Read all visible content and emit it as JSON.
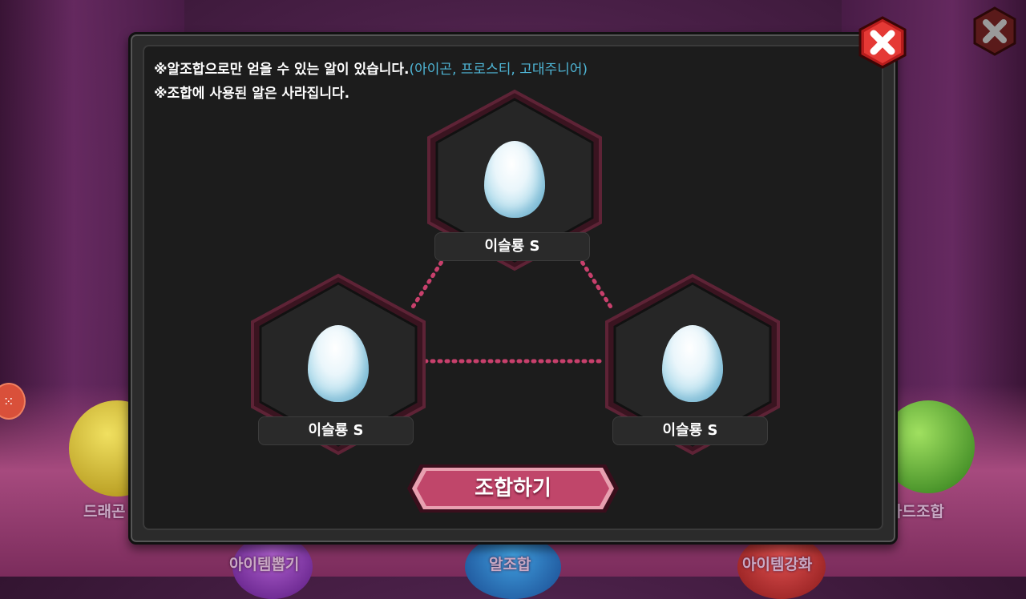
{
  "background": {
    "menu_labels": [
      "드래곤",
      "아이템뽑기",
      "알조합",
      "아이템강화",
      "카드조합"
    ],
    "side_icon": "dice-icon"
  },
  "modal": {
    "notice_line1": "※알조합으로만 얻을 수 있는 알이 있습니다.",
    "notice_line1_highlight": "(아이곤, 프로스티, 고대주니어)",
    "notice_line2": "※조합에 사용된 알은 사라집니다.",
    "close_icon": "close-x-icon",
    "slots": [
      {
        "label": "이슬룡 S",
        "icon": "blue-egg-icon"
      },
      {
        "label": "이슬룡 S",
        "icon": "blue-egg-icon"
      },
      {
        "label": "이슬룡 S",
        "icon": "blue-egg-icon"
      }
    ],
    "combine_button": "조합하기"
  },
  "colors": {
    "highlight_text": "#4fb6d6",
    "button_pink": "#c0466a",
    "close_red": "#d62828",
    "link_dots": "#c8406c"
  }
}
